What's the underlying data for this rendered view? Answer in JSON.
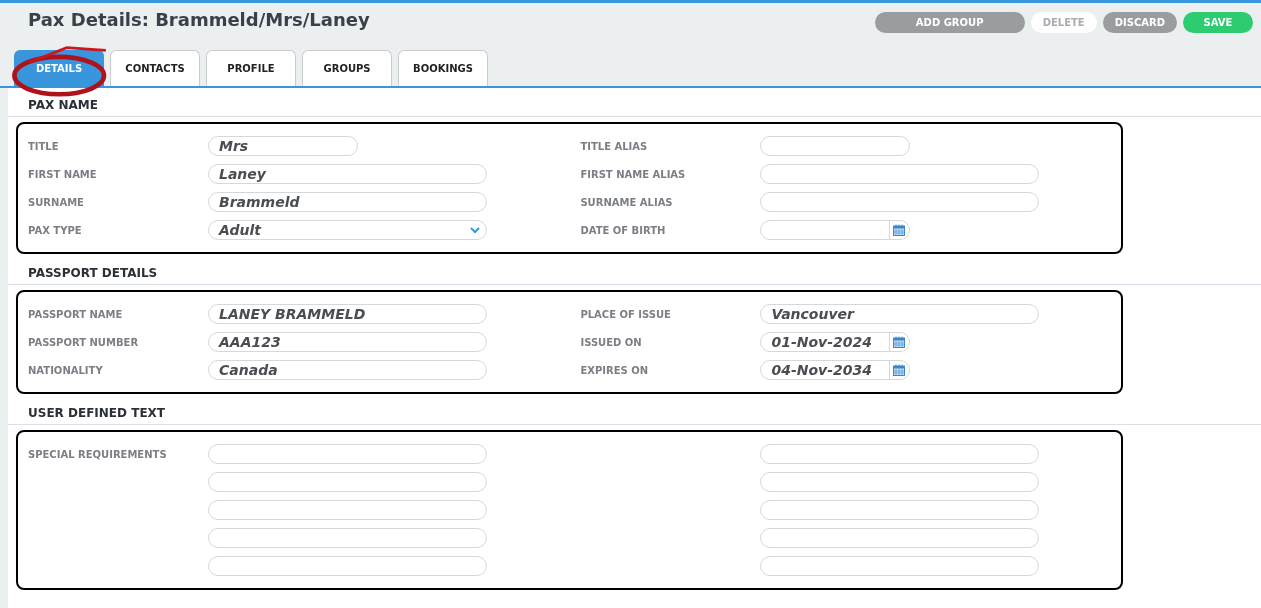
{
  "header": {
    "title": "Pax Details: Brammeld/Mrs/Laney"
  },
  "buttons": [
    {
      "label": "ADD GROUP",
      "kind": "wide",
      "disabled": false
    },
    {
      "label": "DELETE",
      "kind": "normal",
      "disabled": true
    },
    {
      "label": "DISCARD",
      "kind": "normal",
      "disabled": false
    },
    {
      "label": "SAVE",
      "kind": "primary",
      "disabled": false
    }
  ],
  "tabs": [
    {
      "label": "DETAILS",
      "selected": true,
      "annotated": true
    },
    {
      "label": "CONTACTS",
      "selected": false,
      "annotated": false
    },
    {
      "label": "PROFILE",
      "selected": false,
      "annotated": false
    },
    {
      "label": "GROUPS",
      "selected": false,
      "annotated": false
    },
    {
      "label": "BOOKINGS",
      "selected": false,
      "annotated": false
    }
  ],
  "sections": [
    {
      "heading": "PAX NAME",
      "rows": [
        {
          "cells": [
            {
              "label": "TITLE",
              "field": {
                "kind": "short-text",
                "value": "Mrs"
              }
            },
            {
              "label": "TITLE ALIAS",
              "field": {
                "kind": "short-text"
              }
            }
          ]
        },
        {
          "cells": [
            {
              "label": "FIRST NAME",
              "field": {
                "kind": "text",
                "value": "Laney"
              }
            },
            {
              "label": "FIRST NAME ALIAS",
              "field": {
                "kind": "text"
              }
            }
          ]
        },
        {
          "cells": [
            {
              "label": "SURNAME",
              "field": {
                "kind": "text",
                "value": "Brammeld"
              }
            },
            {
              "label": "SURNAME ALIAS",
              "field": {
                "kind": "text"
              }
            }
          ]
        },
        {
          "cells": [
            {
              "label": "PAX TYPE",
              "field": {
                "kind": "select",
                "value": "Adult"
              }
            },
            {
              "label": "DATE OF BIRTH",
              "field": {
                "kind": "date"
              }
            }
          ]
        }
      ]
    },
    {
      "heading": "PASSPORT DETAILS",
      "rows": [
        {
          "cells": [
            {
              "label": "PASSPORT NAME",
              "field": {
                "kind": "text",
                "value": "LANEY BRAMMELD"
              }
            },
            {
              "label": "PLACE OF ISSUE",
              "field": {
                "kind": "text",
                "value": "Vancouver"
              }
            }
          ]
        },
        {
          "cells": [
            {
              "label": "PASSPORT NUMBER",
              "field": {
                "kind": "text",
                "value": "AAA123"
              }
            },
            {
              "label": "ISSUED ON",
              "field": {
                "kind": "date",
                "value": "01-Nov-2024"
              }
            }
          ]
        },
        {
          "cells": [
            {
              "label": "NATIONALITY",
              "field": {
                "kind": "text",
                "value": "Canada"
              }
            },
            {
              "label": "EXPIRES ON",
              "field": {
                "kind": "date",
                "value": "04-Nov-2034"
              }
            }
          ]
        }
      ]
    },
    {
      "heading": "USER DEFINED TEXT",
      "rows": [
        {
          "cells": [
            {
              "label": "SPECIAL REQUIREMENTS",
              "field": {
                "kind": "text"
              }
            },
            {
              "field": {
                "kind": "text"
              }
            }
          ]
        },
        {
          "cells": [
            {
              "field": {
                "kind": "text"
              }
            },
            {
              "field": {
                "kind": "text"
              }
            }
          ]
        },
        {
          "cells": [
            {
              "field": {
                "kind": "text"
              }
            },
            {
              "field": {
                "kind": "text"
              }
            }
          ]
        },
        {
          "cells": [
            {
              "field": {
                "kind": "text"
              }
            },
            {
              "field": {
                "kind": "text"
              }
            }
          ]
        },
        {
          "cells": [
            {
              "field": {
                "kind": "text"
              }
            },
            {
              "field": {
                "kind": "text"
              }
            }
          ]
        }
      ]
    }
  ]
}
